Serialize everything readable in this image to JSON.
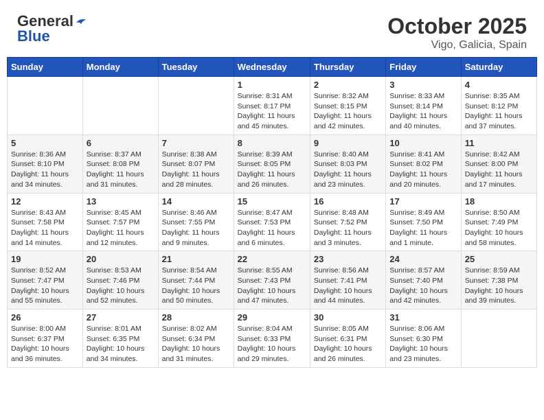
{
  "header": {
    "logo_general": "General",
    "logo_blue": "Blue",
    "title": "October 2025",
    "subtitle": "Vigo, Galicia, Spain"
  },
  "weekdays": [
    "Sunday",
    "Monday",
    "Tuesday",
    "Wednesday",
    "Thursday",
    "Friday",
    "Saturday"
  ],
  "weeks": [
    [
      {
        "day": "",
        "info": ""
      },
      {
        "day": "",
        "info": ""
      },
      {
        "day": "",
        "info": ""
      },
      {
        "day": "1",
        "info": "Sunrise: 8:31 AM\nSunset: 8:17 PM\nDaylight: 11 hours and 45 minutes."
      },
      {
        "day": "2",
        "info": "Sunrise: 8:32 AM\nSunset: 8:15 PM\nDaylight: 11 hours and 42 minutes."
      },
      {
        "day": "3",
        "info": "Sunrise: 8:33 AM\nSunset: 8:14 PM\nDaylight: 11 hours and 40 minutes."
      },
      {
        "day": "4",
        "info": "Sunrise: 8:35 AM\nSunset: 8:12 PM\nDaylight: 11 hours and 37 minutes."
      }
    ],
    [
      {
        "day": "5",
        "info": "Sunrise: 8:36 AM\nSunset: 8:10 PM\nDaylight: 11 hours and 34 minutes."
      },
      {
        "day": "6",
        "info": "Sunrise: 8:37 AM\nSunset: 8:08 PM\nDaylight: 11 hours and 31 minutes."
      },
      {
        "day": "7",
        "info": "Sunrise: 8:38 AM\nSunset: 8:07 PM\nDaylight: 11 hours and 28 minutes."
      },
      {
        "day": "8",
        "info": "Sunrise: 8:39 AM\nSunset: 8:05 PM\nDaylight: 11 hours and 26 minutes."
      },
      {
        "day": "9",
        "info": "Sunrise: 8:40 AM\nSunset: 8:03 PM\nDaylight: 11 hours and 23 minutes."
      },
      {
        "day": "10",
        "info": "Sunrise: 8:41 AM\nSunset: 8:02 PM\nDaylight: 11 hours and 20 minutes."
      },
      {
        "day": "11",
        "info": "Sunrise: 8:42 AM\nSunset: 8:00 PM\nDaylight: 11 hours and 17 minutes."
      }
    ],
    [
      {
        "day": "12",
        "info": "Sunrise: 8:43 AM\nSunset: 7:58 PM\nDaylight: 11 hours and 14 minutes."
      },
      {
        "day": "13",
        "info": "Sunrise: 8:45 AM\nSunset: 7:57 PM\nDaylight: 11 hours and 12 minutes."
      },
      {
        "day": "14",
        "info": "Sunrise: 8:46 AM\nSunset: 7:55 PM\nDaylight: 11 hours and 9 minutes."
      },
      {
        "day": "15",
        "info": "Sunrise: 8:47 AM\nSunset: 7:53 PM\nDaylight: 11 hours and 6 minutes."
      },
      {
        "day": "16",
        "info": "Sunrise: 8:48 AM\nSunset: 7:52 PM\nDaylight: 11 hours and 3 minutes."
      },
      {
        "day": "17",
        "info": "Sunrise: 8:49 AM\nSunset: 7:50 PM\nDaylight: 11 hours and 1 minute."
      },
      {
        "day": "18",
        "info": "Sunrise: 8:50 AM\nSunset: 7:49 PM\nDaylight: 10 hours and 58 minutes."
      }
    ],
    [
      {
        "day": "19",
        "info": "Sunrise: 8:52 AM\nSunset: 7:47 PM\nDaylight: 10 hours and 55 minutes."
      },
      {
        "day": "20",
        "info": "Sunrise: 8:53 AM\nSunset: 7:46 PM\nDaylight: 10 hours and 52 minutes."
      },
      {
        "day": "21",
        "info": "Sunrise: 8:54 AM\nSunset: 7:44 PM\nDaylight: 10 hours and 50 minutes."
      },
      {
        "day": "22",
        "info": "Sunrise: 8:55 AM\nSunset: 7:43 PM\nDaylight: 10 hours and 47 minutes."
      },
      {
        "day": "23",
        "info": "Sunrise: 8:56 AM\nSunset: 7:41 PM\nDaylight: 10 hours and 44 minutes."
      },
      {
        "day": "24",
        "info": "Sunrise: 8:57 AM\nSunset: 7:40 PM\nDaylight: 10 hours and 42 minutes."
      },
      {
        "day": "25",
        "info": "Sunrise: 8:59 AM\nSunset: 7:38 PM\nDaylight: 10 hours and 39 minutes."
      }
    ],
    [
      {
        "day": "26",
        "info": "Sunrise: 8:00 AM\nSunset: 6:37 PM\nDaylight: 10 hours and 36 minutes."
      },
      {
        "day": "27",
        "info": "Sunrise: 8:01 AM\nSunset: 6:35 PM\nDaylight: 10 hours and 34 minutes."
      },
      {
        "day": "28",
        "info": "Sunrise: 8:02 AM\nSunset: 6:34 PM\nDaylight: 10 hours and 31 minutes."
      },
      {
        "day": "29",
        "info": "Sunrise: 8:04 AM\nSunset: 6:33 PM\nDaylight: 10 hours and 29 minutes."
      },
      {
        "day": "30",
        "info": "Sunrise: 8:05 AM\nSunset: 6:31 PM\nDaylight: 10 hours and 26 minutes."
      },
      {
        "day": "31",
        "info": "Sunrise: 8:06 AM\nSunset: 6:30 PM\nDaylight: 10 hours and 23 minutes."
      },
      {
        "day": "",
        "info": ""
      }
    ]
  ]
}
